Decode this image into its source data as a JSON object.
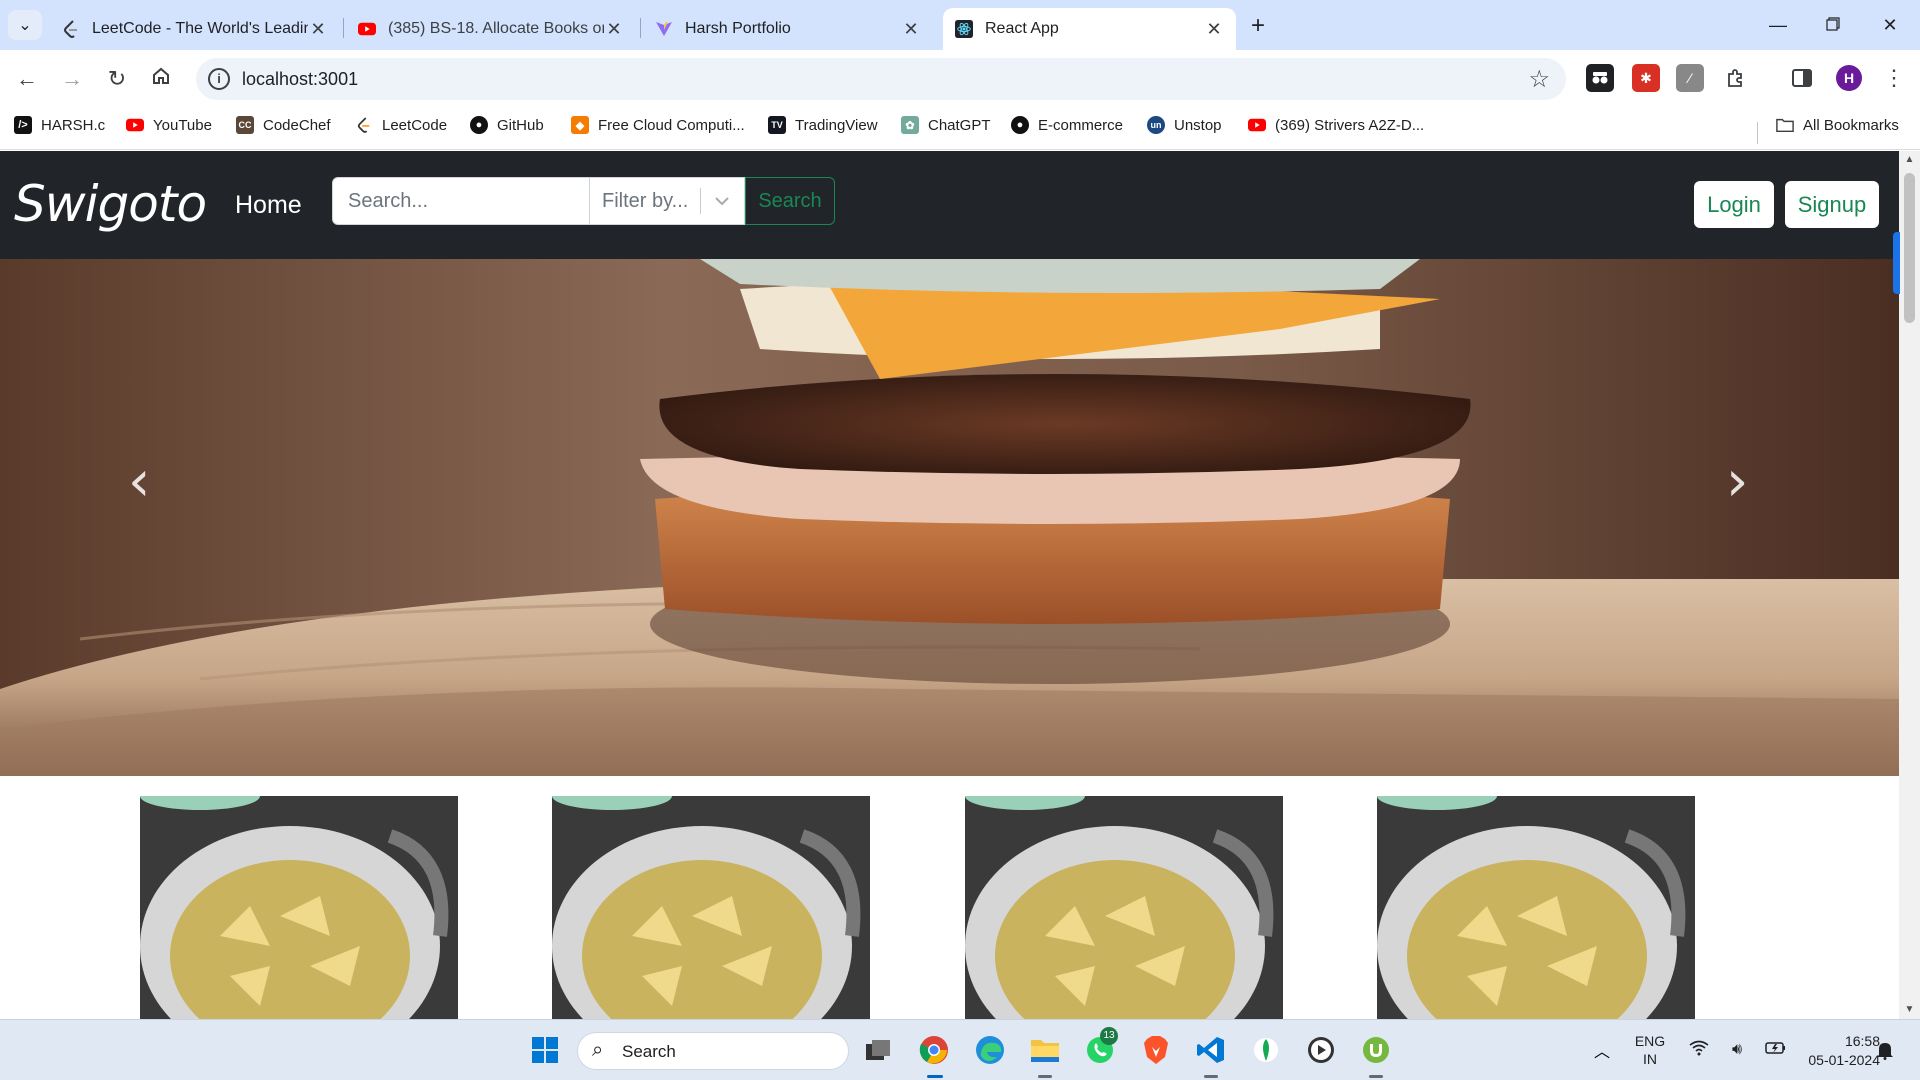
{
  "browser": {
    "tabs": [
      {
        "title": "LeetCode - The World's Leading",
        "icon": "leetcode-icon"
      },
      {
        "title": "(385) BS-18. Allocate Books or B",
        "icon": "youtube-icon"
      },
      {
        "title": "Harsh Portfolio",
        "icon": "vite-icon"
      },
      {
        "title": "React App",
        "icon": "react-icon"
      }
    ],
    "url": "localhost:3001",
    "profile_initial": "H"
  },
  "bookmarks": {
    "items": [
      {
        "label": "HARSH.c"
      },
      {
        "label": "YouTube"
      },
      {
        "label": "CodeChef"
      },
      {
        "label": "LeetCode"
      },
      {
        "label": "GitHub"
      },
      {
        "label": "Free Cloud Computi..."
      },
      {
        "label": "TradingView"
      },
      {
        "label": "ChatGPT"
      },
      {
        "label": "E-commerce"
      },
      {
        "label": "Unstop"
      },
      {
        "label": "(369) Strivers A2Z-D..."
      }
    ],
    "all_label": "All Bookmarks"
  },
  "app": {
    "brand": "Swigoto",
    "nav_home": "Home",
    "search_placeholder": "Search...",
    "filter_placeholder": "Filter by...",
    "search_button": "Search",
    "login": "Login",
    "signup": "Signup",
    "carousel": {
      "prev": "‹",
      "next": "›"
    }
  },
  "taskbar": {
    "search_label": "Search",
    "whatsapp_badge": "13",
    "lang_line1": "ENG",
    "lang_line2": "IN",
    "time": "16:58",
    "date": "05-01-2024"
  },
  "colors": {
    "navbar_bg": "#212529",
    "accent_green": "#198754",
    "tabstrip_bg": "#d3e3fd"
  }
}
